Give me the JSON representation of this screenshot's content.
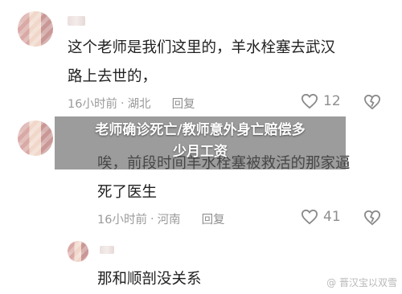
{
  "comments": [
    {
      "text": "这个老师是我们这里的，羊水栓塞去武汉\n路上去世的，",
      "time": "16小时前",
      "location": "湖北",
      "reply_label": "回复",
      "likes": "12"
    },
    {
      "text": "唉，前段时间羊水栓塞被救活的那家逼\n死了医生",
      "time": "16小时前",
      "location": "河南",
      "reply_label": "回复",
      "likes": "41"
    },
    {
      "text": "那和顺剖没关系"
    }
  ],
  "meta_separator": "·",
  "headline": "老师确诊死亡/教师意外身亡赔偿多\n少月工资",
  "watermark": "@ 晋汉宝以双雪",
  "colors": {
    "overlay": "#5f5f5f",
    "headline_text": "#ffffff",
    "meta_text": "#9a9a9a"
  },
  "icons": {
    "like": "heart-outline-icon",
    "dislike": "broken-heart-icon",
    "watermark": "at-icon"
  }
}
